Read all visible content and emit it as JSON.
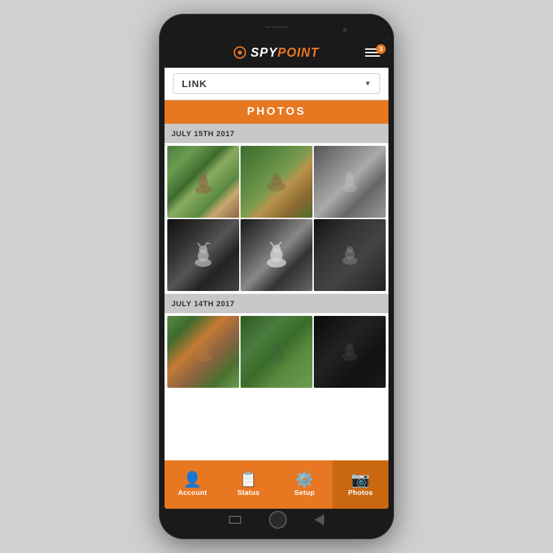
{
  "app": {
    "logo": {
      "spy": "SPY",
      "point": "POINT",
      "trademark": "®"
    },
    "notification_count": "3",
    "camera_name": "LINK",
    "page_title": "PHOTOS"
  },
  "gallery": {
    "sections": [
      {
        "date": "JULY 15TH 2017",
        "photos": [
          {
            "id": 1,
            "style": "day-1",
            "alt": "deer in forest day"
          },
          {
            "id": 2,
            "style": "day-2",
            "alt": "deer running day"
          },
          {
            "id": 3,
            "style": "day-3",
            "alt": "deer grayscale"
          },
          {
            "id": 4,
            "style": "night-1",
            "alt": "deer at night"
          },
          {
            "id": 5,
            "style": "night-2",
            "alt": "deer infrared"
          },
          {
            "id": 6,
            "style": "night-3",
            "alt": "deer night cam"
          }
        ]
      },
      {
        "date": "JULY 14TH 2017",
        "photos": [
          {
            "id": 7,
            "style": "day-4",
            "alt": "deer forest day"
          },
          {
            "id": 8,
            "style": "day-5",
            "alt": "deer green forest"
          },
          {
            "id": 9,
            "style": "night-4",
            "alt": "deer dark night"
          }
        ]
      }
    ]
  },
  "nav": {
    "items": [
      {
        "id": "account",
        "label": "Account",
        "icon": "👤",
        "active": false
      },
      {
        "id": "status",
        "label": "Status",
        "icon": "📋",
        "active": false
      },
      {
        "id": "setup",
        "label": "Setup",
        "icon": "⚙️",
        "active": false
      },
      {
        "id": "photos",
        "label": "Photos",
        "icon": "📷",
        "active": true
      }
    ]
  }
}
